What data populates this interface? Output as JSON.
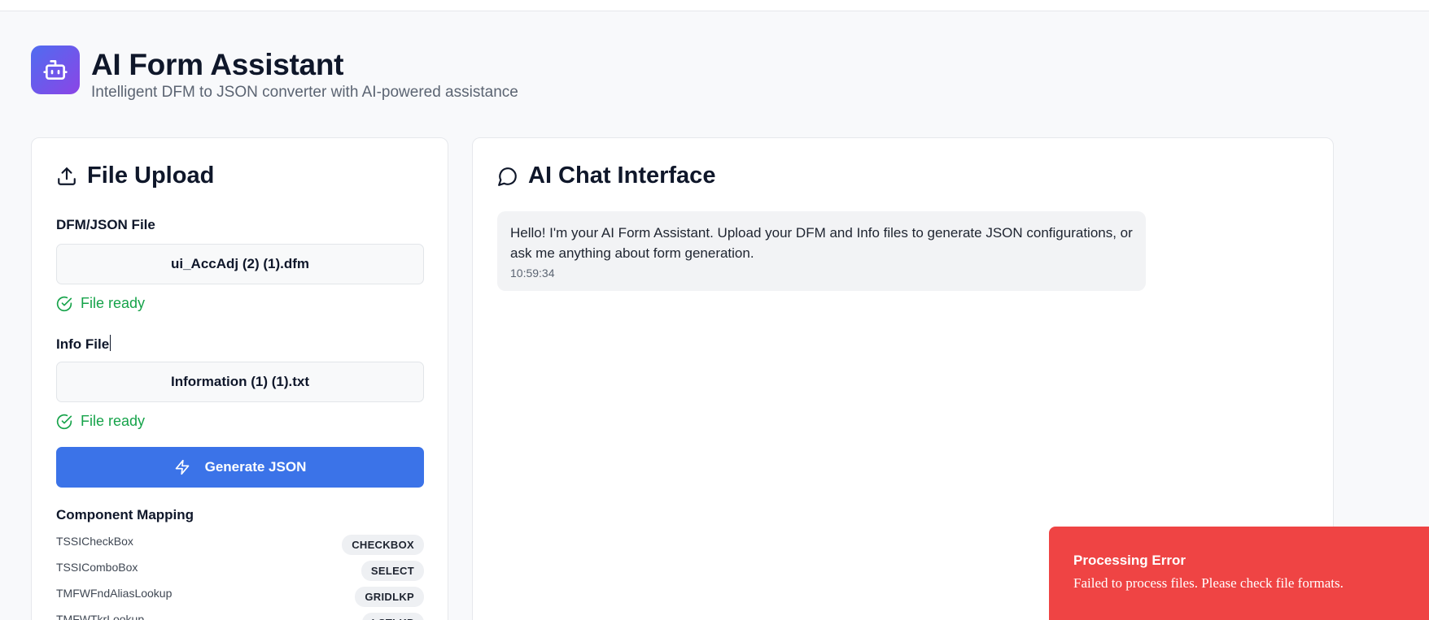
{
  "app": {
    "title": "AI Form Assistant",
    "subtitle": "Intelligent DFM to JSON converter with AI-powered assistance",
    "logo_icon": "robot-icon"
  },
  "upload": {
    "title": "File Upload",
    "title_icon": "upload-icon",
    "dfm_label": "DFM/JSON File",
    "dfm_file": "ui_AccAdj (2) (1).dfm",
    "dfm_status": "File ready",
    "info_label": "Info File",
    "info_file": "Information (1) (1).txt",
    "info_status": "File ready",
    "generate_label": "Generate JSON",
    "generate_icon": "lightning-icon",
    "mapping_title": "Component Mapping",
    "mappings": [
      {
        "name": "TSSICheckBox",
        "type": "CHECKBOX"
      },
      {
        "name": "TSSIComboBox",
        "type": "SELECT"
      },
      {
        "name": "TMFWFndAliasLookup",
        "type": "GRIDLKP"
      },
      {
        "name": "TMFWTkrLookup",
        "type": "LSTLKP"
      }
    ]
  },
  "chat": {
    "title": "AI Chat Interface",
    "title_icon": "message-circle-icon",
    "messages": [
      {
        "text": "Hello! I'm your AI Form Assistant. Upload your DFM and Info files to generate JSON configurations, or ask me anything about form generation.",
        "time": "10:59:34"
      }
    ]
  },
  "toast": {
    "title": "Processing Error",
    "message": "Failed to process files. Please check file formats.",
    "color": "#ef4444"
  },
  "colors": {
    "primary": "#3b73e8",
    "success": "#16a34a",
    "logo_gradient_start": "#4f6cf0",
    "logo_gradient_end": "#8b45e6"
  }
}
